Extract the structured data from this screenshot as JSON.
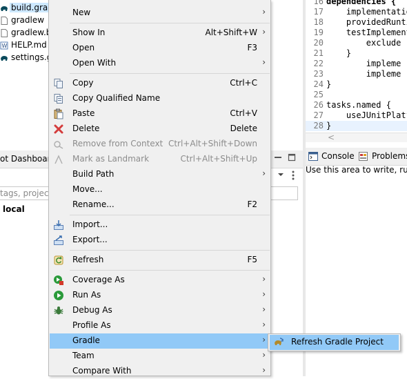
{
  "explorer": {
    "items": [
      {
        "label": "build.grad",
        "icon": "gradle-elephant-icon"
      },
      {
        "label": "gradlew",
        "icon": "file-icon"
      },
      {
        "label": "gradlew.b",
        "icon": "file-icon"
      },
      {
        "label": "HELP.md",
        "icon": "markdown-file-icon"
      },
      {
        "label": "settings.gr",
        "icon": "gradle-elephant-icon"
      }
    ]
  },
  "dashboard": {
    "tab_label": "ot Dashboard",
    "filter_placeholder": "tags, projects",
    "local_label": "local"
  },
  "editor": {
    "lines": [
      {
        "num": "16",
        "keyword": "",
        "text": "dependencies {"
      },
      {
        "num": "17",
        "keyword": "",
        "text": "    implementation"
      },
      {
        "num": "18",
        "keyword": "",
        "text": "    providedRuntim"
      },
      {
        "num": "19",
        "keyword": "",
        "text": "    testImplementa"
      },
      {
        "num": "20",
        "keyword": "",
        "text": "        exclude"
      },
      {
        "num": "21",
        "keyword": "",
        "text": "    }"
      },
      {
        "num": "22",
        "keyword": "",
        "text": "        impleme"
      },
      {
        "num": "23",
        "keyword": "",
        "text": "        impleme"
      },
      {
        "num": "24",
        "keyword": "",
        "text": "}"
      },
      {
        "num": "25",
        "keyword": "",
        "text": ""
      },
      {
        "num": "26",
        "keyword": "",
        "text": "tasks.named {"
      },
      {
        "num": "27",
        "keyword": "",
        "text": "    useJUnitPlatf"
      },
      {
        "num": "28",
        "keyword": "",
        "text": "}"
      }
    ],
    "scroll_left": "<"
  },
  "console": {
    "tabs": [
      {
        "label": "Console",
        "icon": "console-icon"
      },
      {
        "label": "Problems",
        "icon": "problems-icon"
      }
    ],
    "hint": "Use this area to write, run a"
  },
  "context_menu": {
    "items": [
      {
        "label": "New",
        "shortcut": "",
        "submenu": true,
        "icon": ""
      },
      {
        "label": "Show In",
        "shortcut": "Alt+Shift+W",
        "submenu": true,
        "icon": ""
      },
      {
        "label": "Open",
        "shortcut": "F3",
        "submenu": false,
        "icon": ""
      },
      {
        "label": "Open With",
        "shortcut": "",
        "submenu": true,
        "icon": ""
      },
      {
        "label": "Copy",
        "shortcut": "Ctrl+C",
        "submenu": false,
        "icon": "copy-icon"
      },
      {
        "label": "Copy Qualified Name",
        "shortcut": "",
        "submenu": false,
        "icon": "copy-qualified-icon"
      },
      {
        "label": "Paste",
        "shortcut": "Ctrl+V",
        "submenu": false,
        "icon": "paste-icon"
      },
      {
        "label": "Delete",
        "shortcut": "Delete",
        "submenu": false,
        "icon": "delete-icon"
      },
      {
        "label": "Remove from Context",
        "shortcut": "Ctrl+Alt+Shift+Down",
        "submenu": false,
        "icon": "remove-context-icon"
      },
      {
        "label": "Mark as Landmark",
        "shortcut": "Ctrl+Alt+Shift+Up",
        "submenu": false,
        "icon": "landmark-icon"
      },
      {
        "label": "Build Path",
        "shortcut": "",
        "submenu": true,
        "icon": ""
      },
      {
        "label": "Move...",
        "shortcut": "",
        "submenu": false,
        "icon": ""
      },
      {
        "label": "Rename...",
        "shortcut": "F2",
        "submenu": false,
        "icon": ""
      },
      {
        "label": "Import...",
        "shortcut": "",
        "submenu": false,
        "icon": "import-icon"
      },
      {
        "label": "Export...",
        "shortcut": "",
        "submenu": false,
        "icon": "export-icon"
      },
      {
        "label": "Refresh",
        "shortcut": "F5",
        "submenu": false,
        "icon": "refresh-icon"
      },
      {
        "label": "Coverage As",
        "shortcut": "",
        "submenu": true,
        "icon": "coverage-icon"
      },
      {
        "label": "Run As",
        "shortcut": "",
        "submenu": true,
        "icon": "run-icon"
      },
      {
        "label": "Debug As",
        "shortcut": "",
        "submenu": true,
        "icon": "debug-icon"
      },
      {
        "label": "Profile As",
        "shortcut": "",
        "submenu": true,
        "icon": ""
      },
      {
        "label": "Gradle",
        "shortcut": "",
        "submenu": true,
        "icon": ""
      },
      {
        "label": "Team",
        "shortcut": "",
        "submenu": true,
        "icon": ""
      },
      {
        "label": "Compare With",
        "shortcut": "",
        "submenu": true,
        "icon": ""
      }
    ],
    "arrow": "›"
  },
  "submenu": {
    "label": "Refresh Gradle Project",
    "icon": "refresh-gradle-icon"
  },
  "colors": {
    "highlight": "#91c9f7",
    "menu_bg": "#f0f0f0",
    "selection": "#cde8ff"
  }
}
